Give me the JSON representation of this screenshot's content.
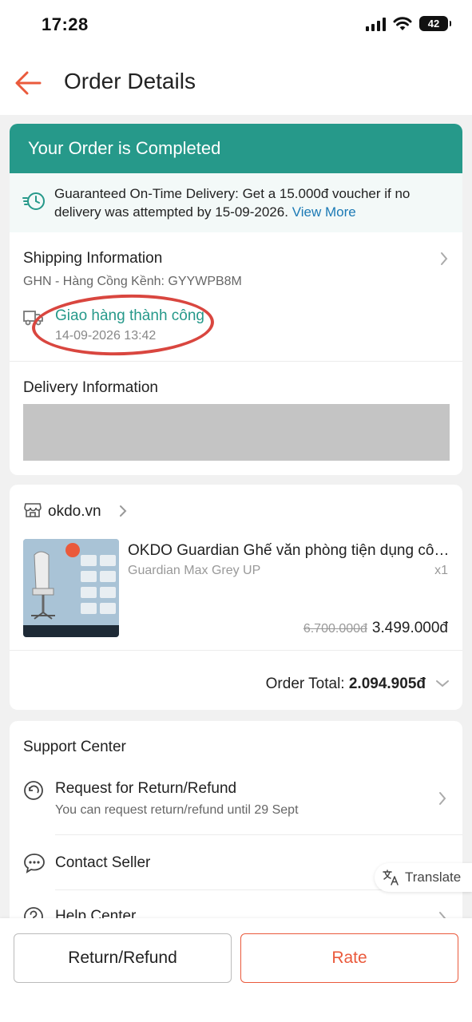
{
  "status_bar": {
    "time": "17:28",
    "battery": "42"
  },
  "header": {
    "title": "Order Details"
  },
  "order_status": {
    "banner": "Your Order is Completed"
  },
  "guarantee": {
    "text": "Guaranteed On-Time Delivery: Get a 15.000đ voucher if no delivery was attempted by 15-09-2026.",
    "link": "View More"
  },
  "shipping": {
    "title": "Shipping Information",
    "carrier": "GHN - Hàng Cồng Kềnh: GYYWPB8M",
    "status": "Giao hàng thành công",
    "date": "14-09-2026 13:42"
  },
  "delivery": {
    "title": "Delivery Information"
  },
  "shop": {
    "name": "okdo.vn"
  },
  "product": {
    "title": "OKDO Guardian Ghế văn phòng tiện dụng công thái học",
    "variant": "Guardian Max Grey UP",
    "qty": "x1",
    "price_old": "6.700.000đ",
    "price_new": "3.499.000đ"
  },
  "order_total": {
    "label": "Order Total:",
    "value": "2.094.905đ"
  },
  "support": {
    "title": "Support Center",
    "items": [
      {
        "label": "Request for Return/Refund",
        "sub": "You can request return/refund until 29 Sept"
      },
      {
        "label": "Contact Seller"
      },
      {
        "label": "Help Center"
      }
    ]
  },
  "translate": {
    "label": "Translate"
  },
  "actions": {
    "return_refund": "Return/Refund",
    "rate": "Rate"
  },
  "colors": {
    "accent": "#ea5a3c",
    "teal": "#26998a",
    "link": "#1c7ab5",
    "annotation": "#d9463f"
  }
}
